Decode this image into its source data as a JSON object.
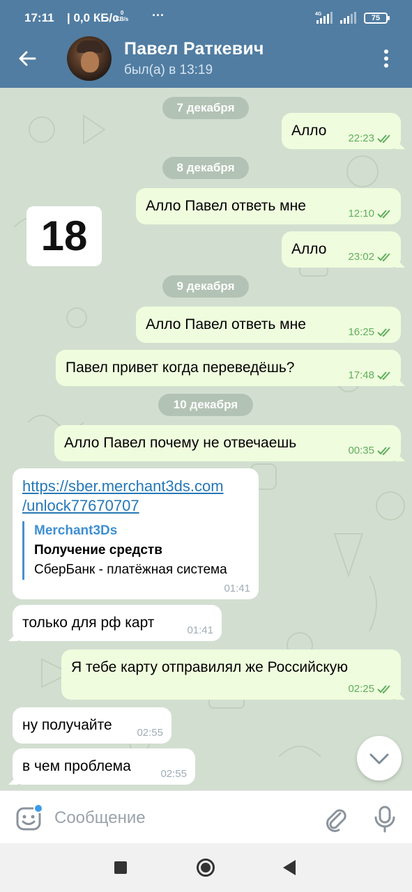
{
  "status_bar": {
    "time": "17:11",
    "network": "| 0,0 КБ/с",
    "kbs_value": "0",
    "kbs_unit": "KB/s",
    "more": "···",
    "network_type": "4G",
    "battery": "75"
  },
  "header": {
    "contact_name": "Павел Раткевич",
    "last_seen": "был(а) в 13:19"
  },
  "day_badge": "18",
  "dates": [
    "7 декабря",
    "8 декабря",
    "9 декабря",
    "10 декабря"
  ],
  "messages": [
    {
      "direction": "out",
      "text": "Алло",
      "time": "22:23"
    },
    {
      "direction": "out",
      "text": "Алло Павел ответь мне",
      "time": "12:10"
    },
    {
      "direction": "out",
      "text": "Алло",
      "time": "23:02"
    },
    {
      "direction": "out",
      "text": "Алло Павел ответь мне",
      "time": "16:25"
    },
    {
      "direction": "out",
      "text": "Павел привет когда переведёшь?",
      "time": "17:48"
    },
    {
      "direction": "out",
      "text": "Алло Павел почему не отвечаешь",
      "time": "00:35"
    },
    {
      "direction": "in",
      "link_line1": "https://sber.merchant3ds.com",
      "link_line2": "/unlock77670707",
      "preview_site": "Merchant3Ds",
      "preview_title": "Получение средств",
      "preview_desc": "СберБанк - платёжная система",
      "time": "01:41"
    },
    {
      "direction": "in",
      "text": "только для рф карт",
      "time": "01:41"
    },
    {
      "direction": "out",
      "text": "Я тебе карту отправилял же Российскую",
      "time": "02:25"
    },
    {
      "direction": "in",
      "text": "ну получайте",
      "time": "02:55"
    },
    {
      "direction": "in",
      "text": "в чем проблема",
      "time": "02:55"
    }
  ],
  "composer": {
    "placeholder": "Сообщение"
  },
  "colors": {
    "header": "#517da2",
    "outgoing_bubble": "#effdde",
    "incoming_bubble": "#ffffff",
    "check_marks": "#5fae5d",
    "link": "#2678b6"
  },
  "icons": [
    "back-arrow-icon",
    "more-vertical-icon",
    "emoji-icon",
    "paperclip-icon",
    "microphone-icon",
    "chevron-down-icon",
    "read-checkmarks-icon"
  ]
}
